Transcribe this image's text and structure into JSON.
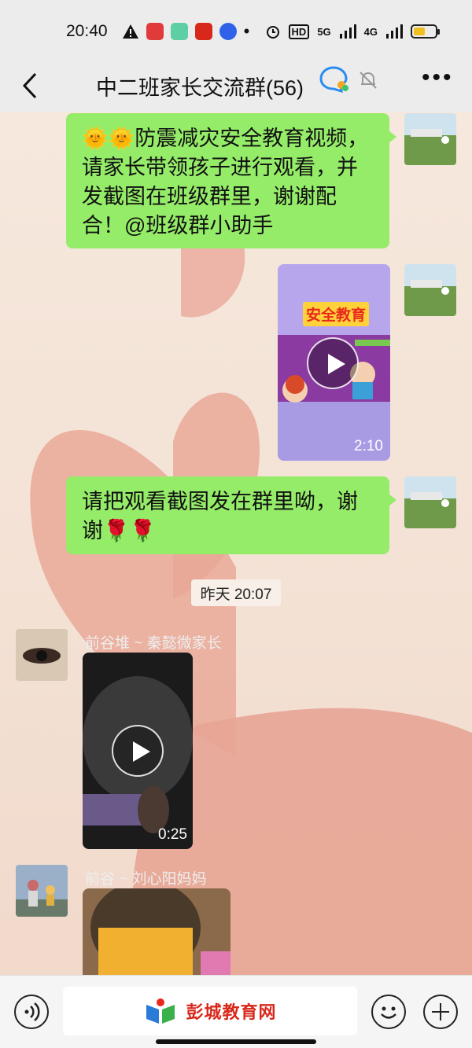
{
  "status_bar": {
    "time": "20:40",
    "network_labels": [
      "HD",
      "5G",
      "4G"
    ],
    "battery_level": 0.55,
    "icons": [
      "warning-icon",
      "app-icon",
      "app-icon",
      "app-icon",
      "baidu-icon",
      "dot-icon",
      "alarm-icon",
      "signal-icon",
      "battery-icon"
    ]
  },
  "header": {
    "title": "中二班家长交流群(56)",
    "icons": [
      "back-arrow-icon",
      "group-chat-icon",
      "mute-bell-icon",
      "more-dots-icon"
    ]
  },
  "messages": [
    {
      "type": "text",
      "from": "me",
      "text_line1": "🌞🌞防震减灾安全教育视频，",
      "text_line2": "请家长带领孩子进行观看，并",
      "text_line3": "发截图在班级群里，谢谢配",
      "text_line4": "合！@班级群小助手"
    },
    {
      "type": "video",
      "from": "me",
      "video_title": "安全教育",
      "duration": "2:10"
    },
    {
      "type": "text",
      "from": "me",
      "text_line1": "请把观看截图发在群里呦，谢",
      "text_line2": "谢🌹🌹"
    },
    {
      "type": "timestamp",
      "text": "昨天 20:07"
    },
    {
      "type": "video",
      "from": "other",
      "sender": "前谷堆 ~ 秦懿微家长",
      "duration": "0:25"
    },
    {
      "type": "image",
      "from": "other",
      "sender": "前谷 ~ 刘心阳妈妈"
    }
  ],
  "input_bar": {
    "watermark_text": "彭城教育网",
    "icons": [
      "voice-icon",
      "emoji-icon",
      "plus-icon"
    ]
  },
  "colors": {
    "my_bubble": "#95ec69",
    "header_bg": "#ececec",
    "wallpaper": "#f3e1d4",
    "heart": "#e8a596"
  }
}
